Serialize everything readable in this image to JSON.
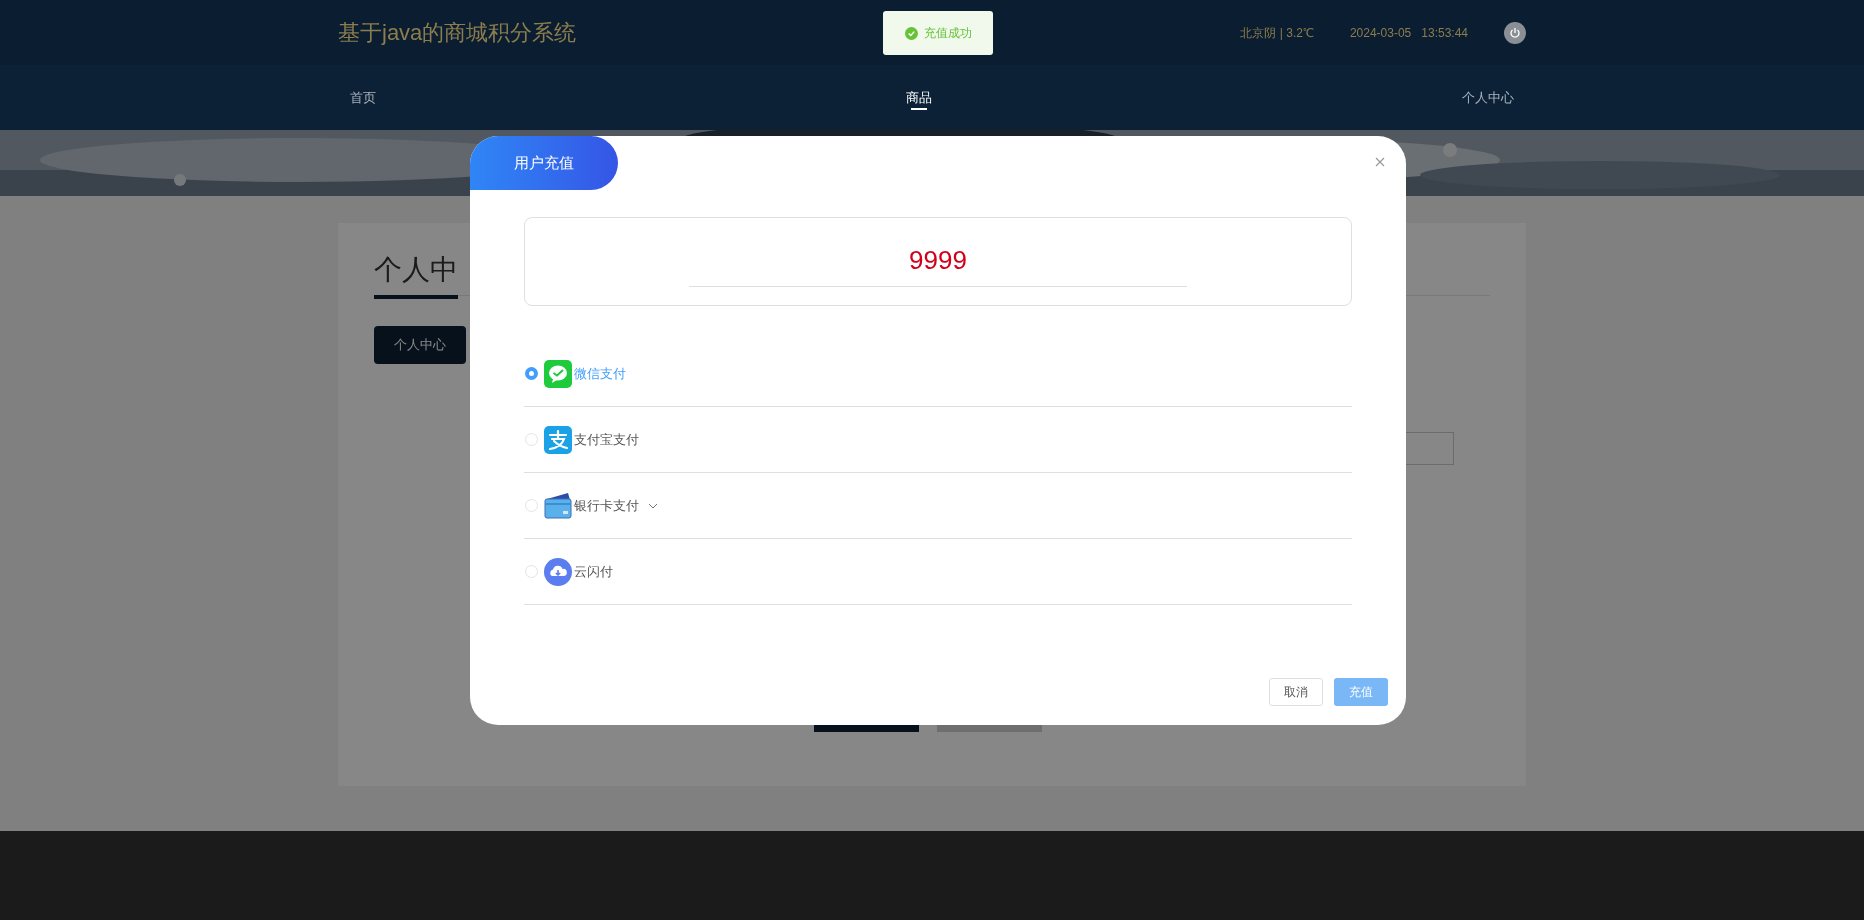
{
  "header": {
    "title": "基于java的商城积分系统",
    "weather": "北京阴 | 3.2℃",
    "date": "2024-03-05",
    "time": "13:53:44"
  },
  "toast": {
    "kind": "success",
    "message": "充值成功"
  },
  "nav": [
    {
      "label": "首页",
      "selected": false
    },
    {
      "label": "商品",
      "selected": true
    },
    {
      "label": "个人中心",
      "selected": false
    }
  ],
  "page": {
    "title": "个人中",
    "menu_button": "个人中心"
  },
  "dialog": {
    "title": "用户充值",
    "amount": "9999",
    "payment_methods": [
      {
        "kind": "wechat",
        "label": "微信支付",
        "selected": true,
        "has_dropdown": false
      },
      {
        "kind": "alipay",
        "label": "支付宝支付",
        "selected": false,
        "has_dropdown": false
      },
      {
        "kind": "bank",
        "label": "银行卡支付",
        "selected": false,
        "has_dropdown": true
      },
      {
        "kind": "cloud",
        "label": "云闪付",
        "selected": false,
        "has_dropdown": false
      }
    ],
    "buttons": [
      {
        "kind": "cancel",
        "label": "取消"
      },
      {
        "kind": "confirm",
        "label": "充值"
      }
    ]
  }
}
